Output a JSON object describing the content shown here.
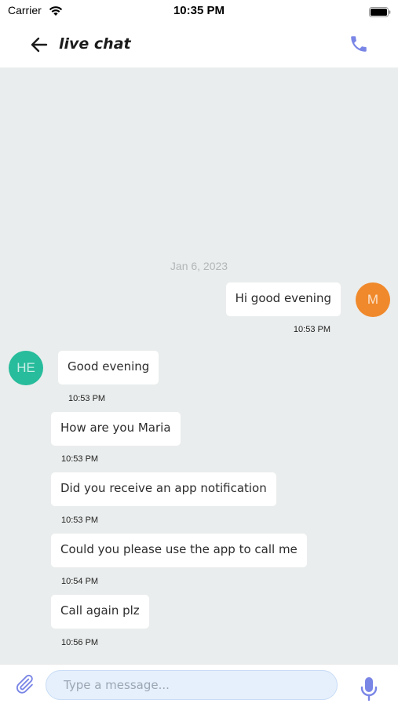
{
  "status_bar": {
    "carrier": "Carrier",
    "time": "10:35 PM",
    "wifi_icon": "wifi-icon",
    "battery_icon": "battery-icon"
  },
  "header": {
    "title": "live chat",
    "back_icon": "arrow-left-icon",
    "call_icon": "phone-icon"
  },
  "chat": {
    "date_separator": "Jan 6, 2023",
    "outgoing_avatar_initials": "M",
    "incoming_avatar_initials": "HE",
    "messages": [
      {
        "direction": "outgoing",
        "text": "Hi good evening",
        "time": "10:53 PM"
      },
      {
        "direction": "incoming",
        "text": "Good evening",
        "time": "10:53 PM"
      },
      {
        "direction": "incoming",
        "text": "How are you Maria",
        "time": "10:53 PM"
      },
      {
        "direction": "incoming",
        "text": "Did you receive an app notification",
        "time": "10:53 PM"
      },
      {
        "direction": "incoming",
        "text": "Could you please use the app to call me",
        "time": "10:54 PM"
      },
      {
        "direction": "incoming",
        "text": "Call again plz",
        "time": "10:56 PM"
      }
    ]
  },
  "input_bar": {
    "placeholder": "Type a message...",
    "value": "",
    "attach_icon": "paperclip-icon",
    "mic_icon": "microphone-icon"
  },
  "colors": {
    "accent": "#7a86e6",
    "chat_background": "#eaeded",
    "outgoing_avatar": "#f0892b",
    "incoming_avatar": "#27bc9c",
    "input_background": "#e6f0fc"
  }
}
